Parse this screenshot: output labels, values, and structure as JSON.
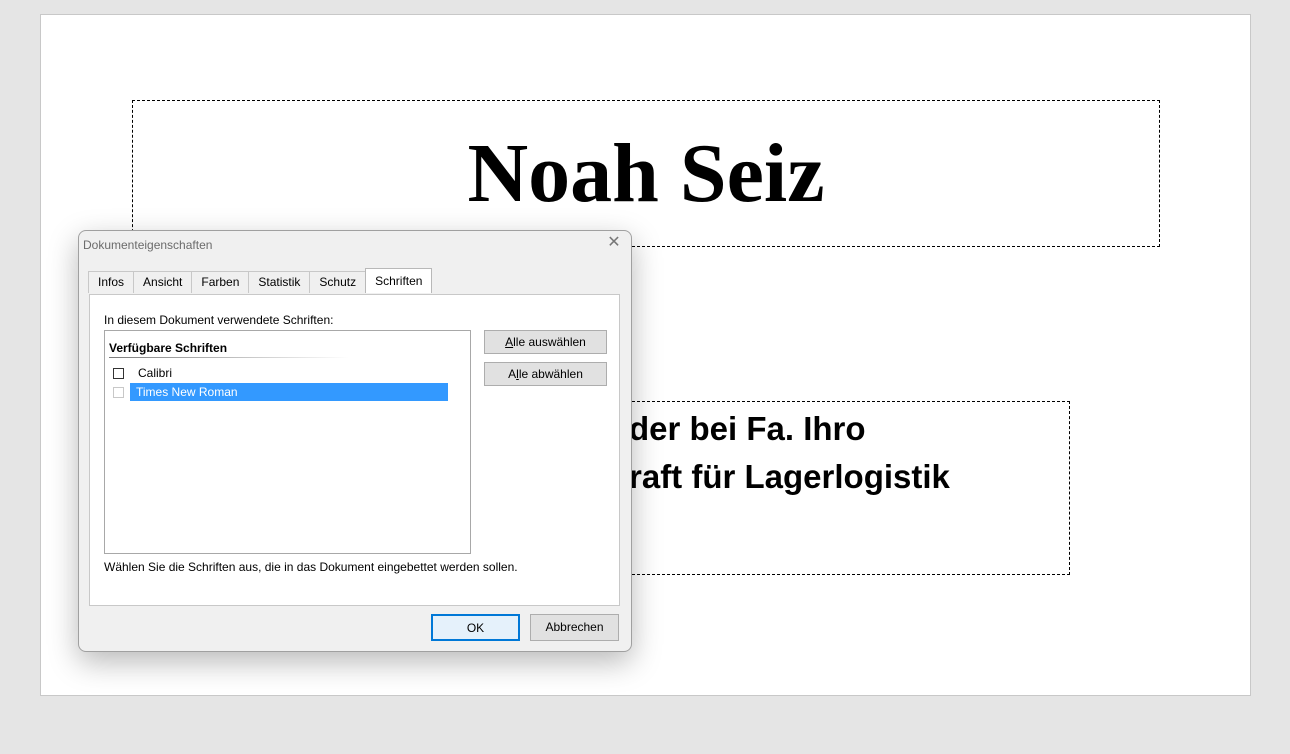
{
  "slide": {
    "title": "Noah Seiz",
    "body_line1": "der bei Fa. Ihro",
    "body_line2": "raft für Lagerlogistik"
  },
  "dialog": {
    "title": "Dokumenteigenschaften",
    "close_icon": "close-icon",
    "tabs": [
      {
        "label": "Infos"
      },
      {
        "label": "Ansicht"
      },
      {
        "label": "Farben"
      },
      {
        "label": "Statistik"
      },
      {
        "label": "Schutz"
      },
      {
        "label": "Schriften",
        "active": true
      }
    ],
    "panel": {
      "label": "In diesem Dokument verwendete Schriften:",
      "list_header": "Verfügbare Schriften",
      "fonts": [
        {
          "name": "Calibri",
          "checked": false,
          "selected": false
        },
        {
          "name": "Times New Roman",
          "checked": false,
          "selected": true
        }
      ],
      "select_all": "Alle auswählen",
      "deselect_all": "Alle abwählen",
      "hint": "Wählen Sie die Schriften aus, die in das Dokument eingebettet werden sollen."
    },
    "ok": "OK",
    "cancel": "Abbrechen"
  },
  "colors": {
    "selection": "#3399ff",
    "default_button_border": "#0078d7"
  }
}
